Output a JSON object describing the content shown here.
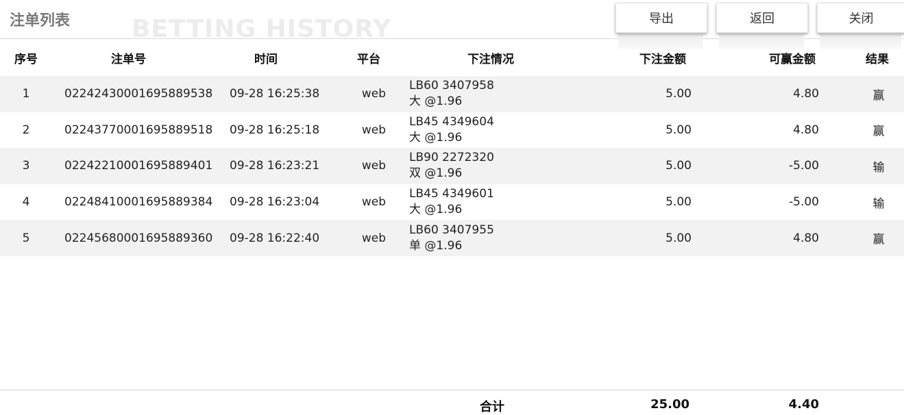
{
  "header": {
    "title": "注单列表",
    "watermark": "BETTING HISTORY",
    "buttons": {
      "export": "导出",
      "back": "返回",
      "close": "关闭"
    }
  },
  "table": {
    "columns": [
      "序号",
      "注单号",
      "时间",
      "平台",
      "下注情况",
      "下注金额",
      "可赢金额",
      "结果"
    ],
    "rows": [
      {
        "index": "1",
        "order_no": "02242430001695889538",
        "time": "09-28 16:25:38",
        "platform": "web",
        "detail_line1": "LB60 3407958",
        "detail_line2": "大 @1.96",
        "amount": "5.00",
        "win_amount": "4.80",
        "result": "赢"
      },
      {
        "index": "2",
        "order_no": "02243770001695889518",
        "time": "09-28 16:25:18",
        "platform": "web",
        "detail_line1": "LB45 4349604",
        "detail_line2": "大 @1.96",
        "amount": "5.00",
        "win_amount": "4.80",
        "result": "赢"
      },
      {
        "index": "3",
        "order_no": "02242210001695889401",
        "time": "09-28 16:23:21",
        "platform": "web",
        "detail_line1": "LB90 2272320",
        "detail_line2": "双 @1.96",
        "amount": "5.00",
        "win_amount": "-5.00",
        "result": "输"
      },
      {
        "index": "4",
        "order_no": "02248410001695889384",
        "time": "09-28 16:23:04",
        "platform": "web",
        "detail_line1": "LB45 4349601",
        "detail_line2": "大 @1.96",
        "amount": "5.00",
        "win_amount": "-5.00",
        "result": "输"
      },
      {
        "index": "5",
        "order_no": "02245680001695889360",
        "time": "09-28 16:22:40",
        "platform": "web",
        "detail_line1": "LB60 3407955",
        "detail_line2": "单 @1.96",
        "amount": "5.00",
        "win_amount": "4.80",
        "result": "赢"
      }
    ]
  },
  "footer": {
    "total_label": "合计",
    "total_amount": "25.00",
    "total_win": "4.40"
  }
}
